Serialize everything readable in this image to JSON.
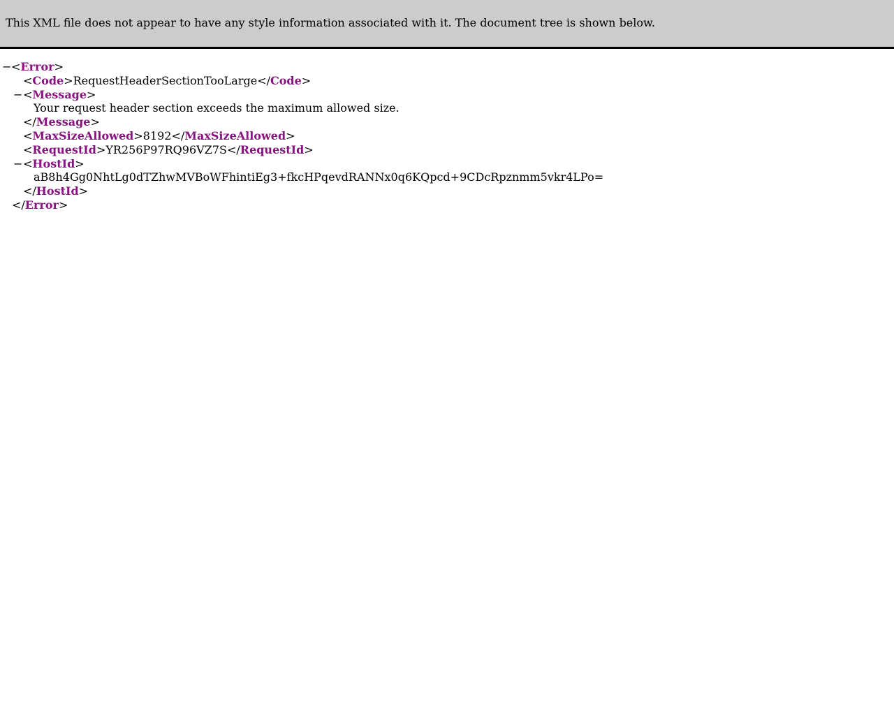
{
  "banner": {
    "message": "This XML file does not appear to have any style information associated with it. The document tree is shown below."
  },
  "symbols": {
    "collapse": "−",
    "lt": "<",
    "gt": ">",
    "lt_close": "</"
  },
  "colors": {
    "tag_name": "#881280",
    "banner_bg": "#cccccc"
  },
  "xml": {
    "root": "Error",
    "code_tag": "Code",
    "code_value": "RequestHeaderSectionTooLarge",
    "message_tag": "Message",
    "message_value": "Your request header section exceeds the maximum allowed size.",
    "maxsize_tag": "MaxSizeAllowed",
    "maxsize_value": "8192",
    "requestid_tag": "RequestId",
    "requestid_value": "YR256P97RQ96VZ7S",
    "hostid_tag": "HostId",
    "hostid_value": "aB8h4Gg0NhtLg0dTZhwMVBoWFhintiEg3+fkcHPqevdRANNx0q6KQpcd+9CDcRpznmm5vkr4LPo="
  }
}
